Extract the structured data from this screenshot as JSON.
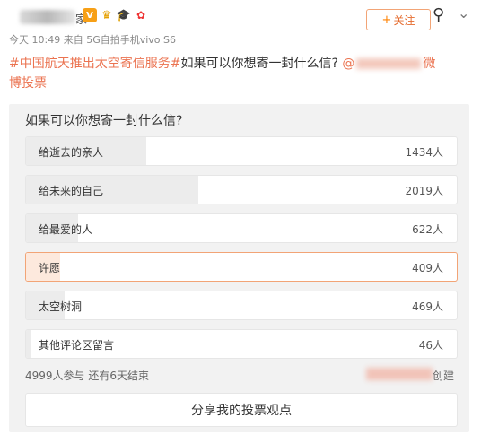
{
  "post": {
    "author_tail": "家",
    "meta": "今天 10:49 来自 5G自拍手机vivo S6",
    "follow_label": "关注",
    "topic": "#中国航天推出太空寄信服务#",
    "text": "如果可以你想寄一封什么信?",
    "link_prefix": "@",
    "link_tail": "微",
    "text2": "博投票"
  },
  "poll": {
    "question": "如果可以你想寄一封什么信?",
    "options": [
      {
        "label": "给逝去的亲人",
        "count": "1434人",
        "votes": 1434,
        "selected": false
      },
      {
        "label": "给未来的自己",
        "count": "2019人",
        "votes": 2019,
        "selected": false
      },
      {
        "label": "给最爱的人",
        "count": "622人",
        "votes": 622,
        "selected": false
      },
      {
        "label": "许愿",
        "count": "409人",
        "votes": 409,
        "selected": true
      },
      {
        "label": "太空树洞",
        "count": "469人",
        "votes": 469,
        "selected": false
      },
      {
        "label": "其他评论区留言",
        "count": "46人",
        "votes": 46,
        "selected": false
      }
    ],
    "summary": "4999人参与 还有6天结束",
    "created_tail": "创建",
    "share_label": "分享我的投票观点"
  },
  "colors": {
    "accent": "#eb7350",
    "selected_border": "#f2a476",
    "bar": "#ececec",
    "bar_selected": "#fde9dd"
  }
}
